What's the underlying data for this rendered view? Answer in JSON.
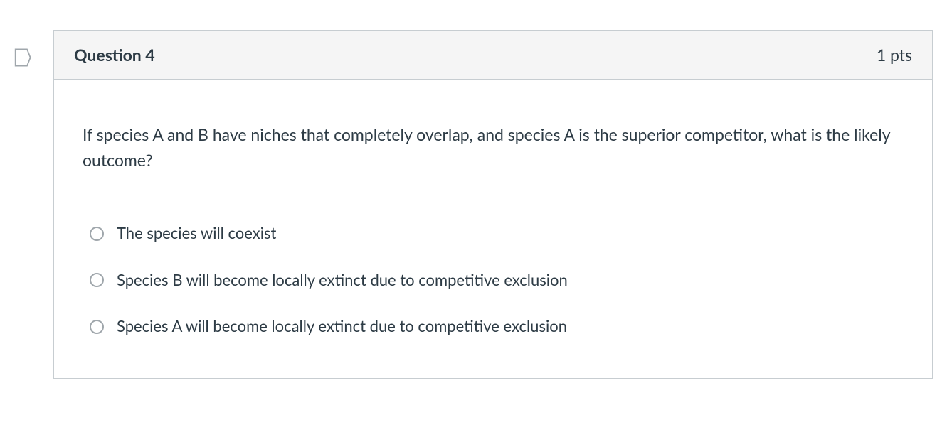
{
  "question": {
    "title": "Question 4",
    "points": "1 pts",
    "text": "If species A and B have niches that completely overlap, and species A is the superior competitor, what is the likely outcome?",
    "answers": [
      "The species will coexist",
      "Species B will become locally extinct due to competitive exclusion",
      "Species A will become locally extinct due to competitive exclusion"
    ]
  }
}
